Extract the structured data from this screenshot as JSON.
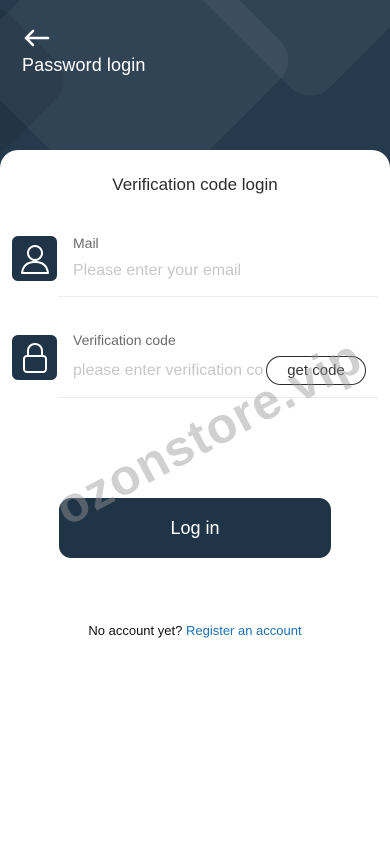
{
  "header": {
    "title": "Password login",
    "back_icon": "arrow-left-icon"
  },
  "card": {
    "title": "Verification code login"
  },
  "mail_field": {
    "label": "Mail",
    "placeholder": "Please enter your email",
    "value": "",
    "icon": "user-icon"
  },
  "code_field": {
    "label": "Verification code",
    "placeholder": "please enter verification code",
    "value": "",
    "icon": "lock-icon",
    "get_code_label": "get code"
  },
  "login_button": {
    "label": "Log in"
  },
  "register": {
    "prompt": "No account yet?",
    "link_label": "Register an account"
  },
  "watermark": {
    "text": "ozonstore.vip"
  },
  "colors": {
    "primary": "#1f3447",
    "header_bg": "#263a4d",
    "link": "#1e6fb5"
  }
}
